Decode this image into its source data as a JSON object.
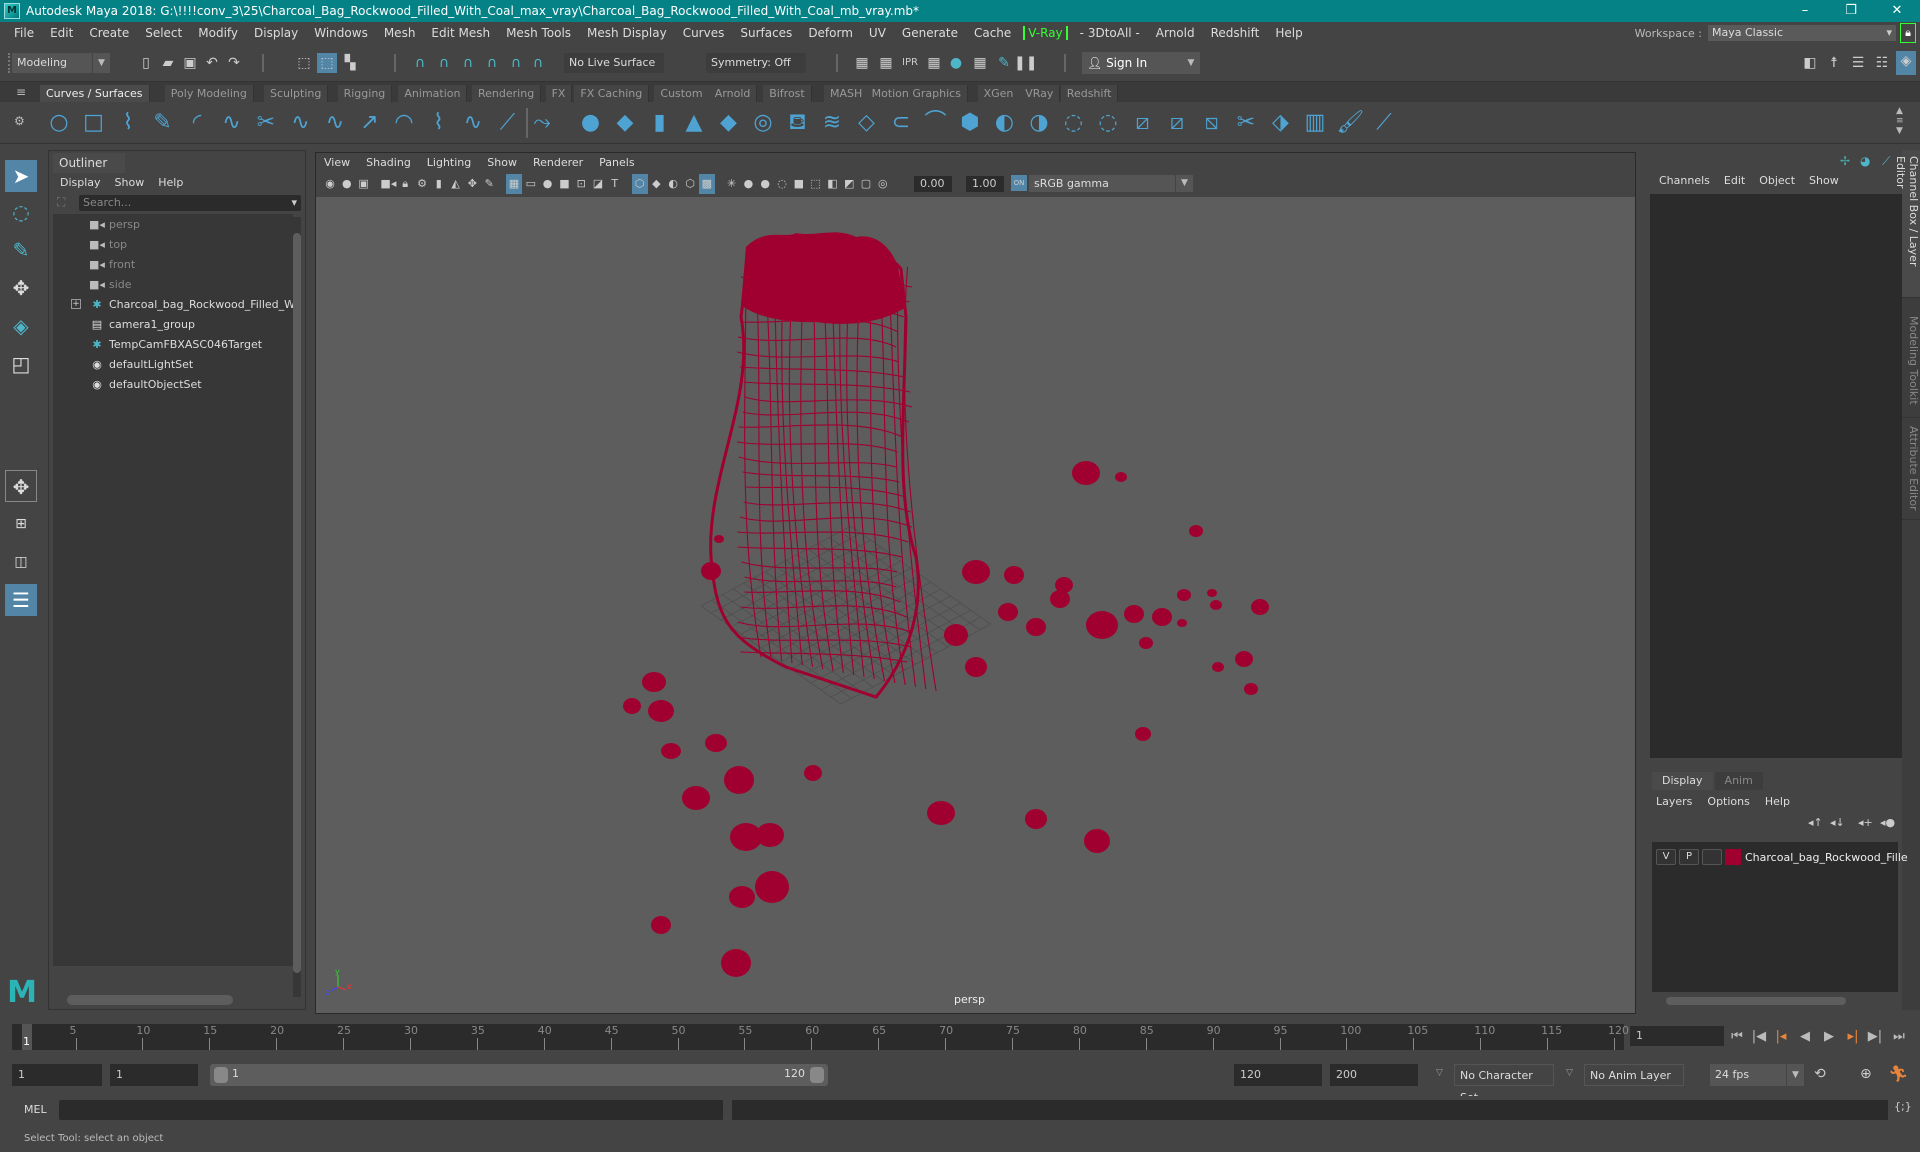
{
  "window": {
    "title": "Autodesk Maya 2018: G:\\!!!!conv_3\\25\\Charcoal_Bag_Rockwood_Filled_With_Coal_max_vray\\Charcoal_Bag_Rockwood_Filled_With_Coal_mb_vray.mb*",
    "logo": "M",
    "minimize": "–",
    "maximize": "❐",
    "close": "✕"
  },
  "menubar": {
    "items": [
      "File",
      "Edit",
      "Create",
      "Select",
      "Modify",
      "Display",
      "Windows",
      "Mesh",
      "Edit Mesh",
      "Mesh Tools",
      "Mesh Display",
      "Curves",
      "Surfaces",
      "Deform",
      "UV",
      "Generate",
      "Cache"
    ],
    "vray": "V-Ray",
    "items_after": [
      "- 3DtoAll -",
      "Arnold",
      "Redshift",
      "Help"
    ],
    "workspace_label": "Workspace :",
    "workspace_value": "Maya Classic"
  },
  "statusline": {
    "mode": "Modeling",
    "live_surface": "No Live Surface",
    "symmetry": "Symmetry: Off",
    "sign_in": "Sign In"
  },
  "shelf": {
    "tabs": [
      "Curves / Surfaces",
      "Poly Modeling",
      "Sculpting",
      "Rigging",
      "Animation",
      "Rendering",
      "FX",
      "FX Caching",
      "Custom",
      "Arnold",
      "Bifrost",
      "MASH",
      "Motion Graphics",
      "XGen",
      "VRay",
      "Redshift"
    ],
    "active_tab": "Curves / Surfaces",
    "icons": [
      "nurbs-circle-icon",
      "nurbs-square-icon",
      "cv-curve-icon",
      "pencil-curve-icon",
      "arc-tool-icon",
      "ep-curve-icon",
      "cut-curve-icon",
      "attach-curve-icon",
      "rebuild-curve-icon",
      "extend-curve-icon",
      "offset-curve-icon",
      "bezier-curve-icon",
      "insert-knot-icon",
      "intersect-curve-icon",
      "fillet-curve-icon",
      "nurbs-sphere-icon",
      "nurbs-cube-icon",
      "nurbs-cylinder-icon",
      "nurbs-cone-icon",
      "nurbs-plane-icon",
      "nurbs-torus-icon",
      "revolve-icon",
      "loft-icon",
      "planar-icon",
      "extrude-icon",
      "birail-icon",
      "bevel-plus-icon",
      "project-curve-icon",
      "intersect-surface-icon",
      "trim-tool-icon",
      "untrim-icon",
      "attach-surface-icon",
      "detach-surface-icon",
      "open-close-icon",
      "stitch-icon",
      "sculpt-surface-icon",
      "rebuild-surface-icon",
      "paint-effects-icon",
      "smooth-icon"
    ]
  },
  "outliner": {
    "title": "Outliner",
    "menu": [
      "Display",
      "Show",
      "Help"
    ],
    "search_placeholder": "Search...",
    "items": [
      {
        "label": "persp",
        "icon": "camera",
        "dim": true,
        "expand": false
      },
      {
        "label": "top",
        "icon": "camera",
        "dim": true,
        "expand": false
      },
      {
        "label": "front",
        "icon": "camera",
        "dim": true,
        "expand": false
      },
      {
        "label": "side",
        "icon": "camera",
        "dim": true,
        "expand": false
      },
      {
        "label": "Charcoal_bag_Rockwood_Filled_With",
        "icon": "transform",
        "dim": false,
        "expand": true
      },
      {
        "label": "camera1_group",
        "icon": "group",
        "dim": false,
        "expand": false
      },
      {
        "label": "TempCamFBXASC046Target",
        "icon": "transform",
        "dim": false,
        "expand": false
      },
      {
        "label": "defaultLightSet",
        "icon": "set",
        "dim": false,
        "expand": false
      },
      {
        "label": "defaultObjectSet",
        "icon": "set",
        "dim": false,
        "expand": false
      }
    ]
  },
  "viewport": {
    "menu": [
      "View",
      "Shading",
      "Lighting",
      "Show",
      "Renderer",
      "Panels"
    ],
    "exposure": "0.00",
    "gamma": "1.00",
    "color_space": "sRGB gamma",
    "camera_label": "persp",
    "axis": {
      "x": "x",
      "y": "y",
      "z": "z"
    },
    "wire_color": "#a00030"
  },
  "channelbox": {
    "menu": [
      "Channels",
      "Edit",
      "Object",
      "Show"
    ]
  },
  "sidetabs": [
    "Channel Box / Layer Editor",
    "Modeling Toolkit",
    "Attribute Editor"
  ],
  "layereditor": {
    "tabs": [
      "Display",
      "Anim"
    ],
    "menu": [
      "Layers",
      "Options",
      "Help"
    ],
    "layer": {
      "v": "V",
      "p": "P",
      "name": "Charcoal_bag_Rockwood_Fille",
      "color": "#a00030"
    }
  },
  "timeline": {
    "ticks": [
      5,
      10,
      15,
      20,
      25,
      30,
      35,
      40,
      45,
      50,
      55,
      60,
      65,
      70,
      75,
      80,
      85,
      90,
      95,
      100,
      105,
      110,
      115,
      120
    ],
    "start": 1,
    "end": 120,
    "current_frame": "1",
    "current_label": "1"
  },
  "range": {
    "start_field": "1",
    "anim_start": "1",
    "range_start": "1",
    "range_end": "120",
    "end_field": "120",
    "anim_end": "200",
    "char_set": "No Character Set",
    "anim_layer": "No Anim Layer",
    "fps": "24 fps"
  },
  "cmdline": {
    "label": "MEL"
  },
  "helpline": {
    "text": "Select Tool: select an object"
  }
}
